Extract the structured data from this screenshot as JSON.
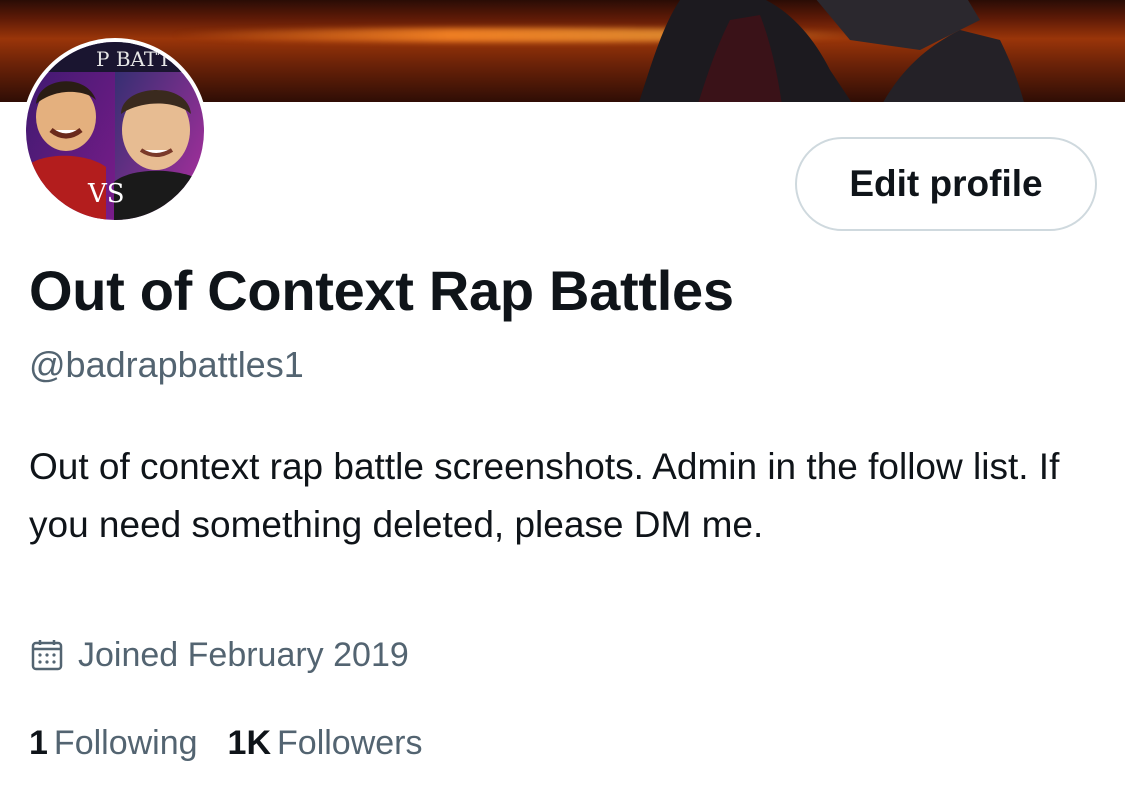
{
  "profile": {
    "avatar_text_top": "P BATT",
    "avatar_text_vs": "VS",
    "edit_label": "Edit profile",
    "display_name": "Out of Context Rap Battles",
    "handle": "@badrapbattles1",
    "bio": "Out of context rap battle screenshots. Admin in the follow list. If you need something deleted, please DM me.",
    "joined": "Joined February 2019",
    "following_count": "1",
    "following_label": "Following",
    "followers_count": "1K",
    "followers_label": "Followers"
  },
  "icons": {
    "joined": "calendar-icon"
  },
  "colors": {
    "text_primary": "#0f1419",
    "text_secondary": "#536471",
    "button_border": "#cfd9de",
    "banner": "#9a3509"
  }
}
